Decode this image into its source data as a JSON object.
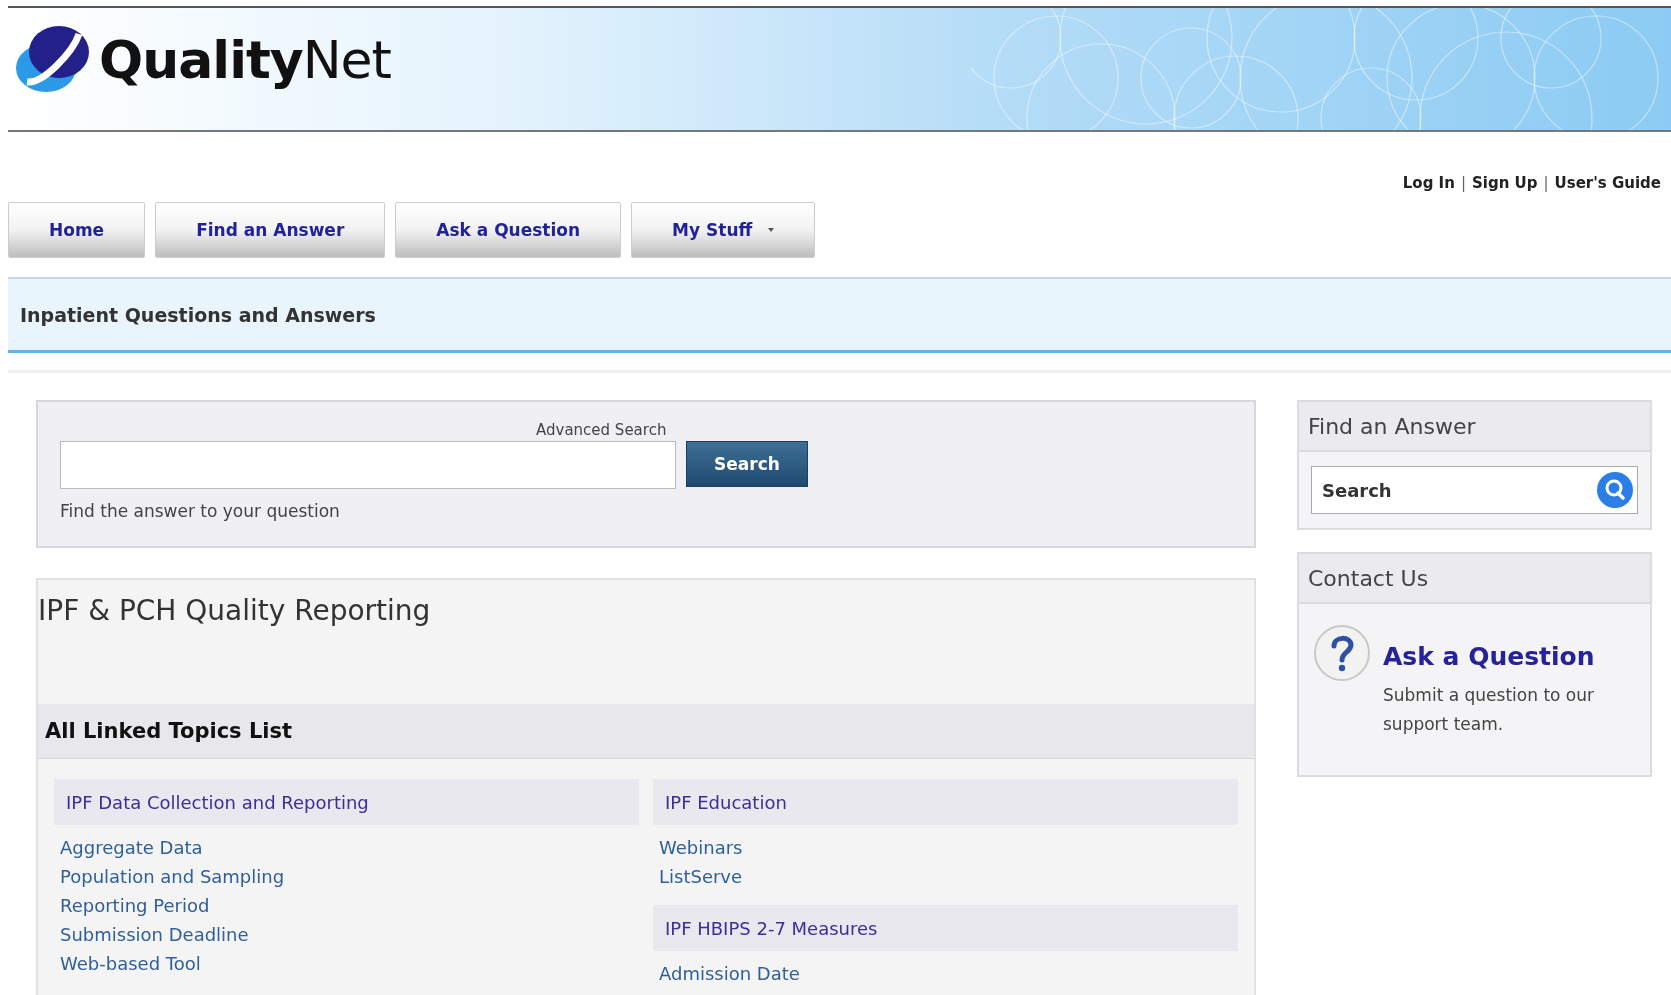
{
  "logo": {
    "bold": "Quality",
    "regular": "Net"
  },
  "user_links": {
    "separator": "|",
    "items": [
      "Log In",
      "Sign Up",
      "User's Guide"
    ]
  },
  "nav": [
    {
      "label": "Home",
      "dropdown": false
    },
    {
      "label": "Find an Answer",
      "dropdown": false
    },
    {
      "label": "Ask a Question",
      "dropdown": false
    },
    {
      "label": "My Stuff",
      "dropdown": true
    }
  ],
  "page_title": "Inpatient Questions and Answers",
  "advanced_search": {
    "label": "Advanced Search",
    "button": "Search",
    "hint": "Find the answer to your question"
  },
  "topics": {
    "title": "IPF & PCH Quality Reporting",
    "list_heading": "All Linked Topics List",
    "columns": [
      [
        {
          "heading": "IPF Data Collection and Reporting",
          "links": [
            "Aggregate Data",
            "Population and Sampling",
            "Reporting Period",
            "Submission Deadline",
            "Web-based Tool"
          ]
        }
      ],
      [
        {
          "heading": "IPF Education",
          "links": [
            "Webinars",
            "ListServe"
          ]
        },
        {
          "heading": "IPF HBIPS 2-7 Measures",
          "links": [
            "Admission Date"
          ]
        }
      ]
    ]
  },
  "sidebar": {
    "find": {
      "title": "Find an Answer",
      "placeholder": "Search"
    },
    "contact": {
      "title": "Contact Us",
      "link": "Ask a Question",
      "text": "Submit a question to our support team."
    }
  }
}
